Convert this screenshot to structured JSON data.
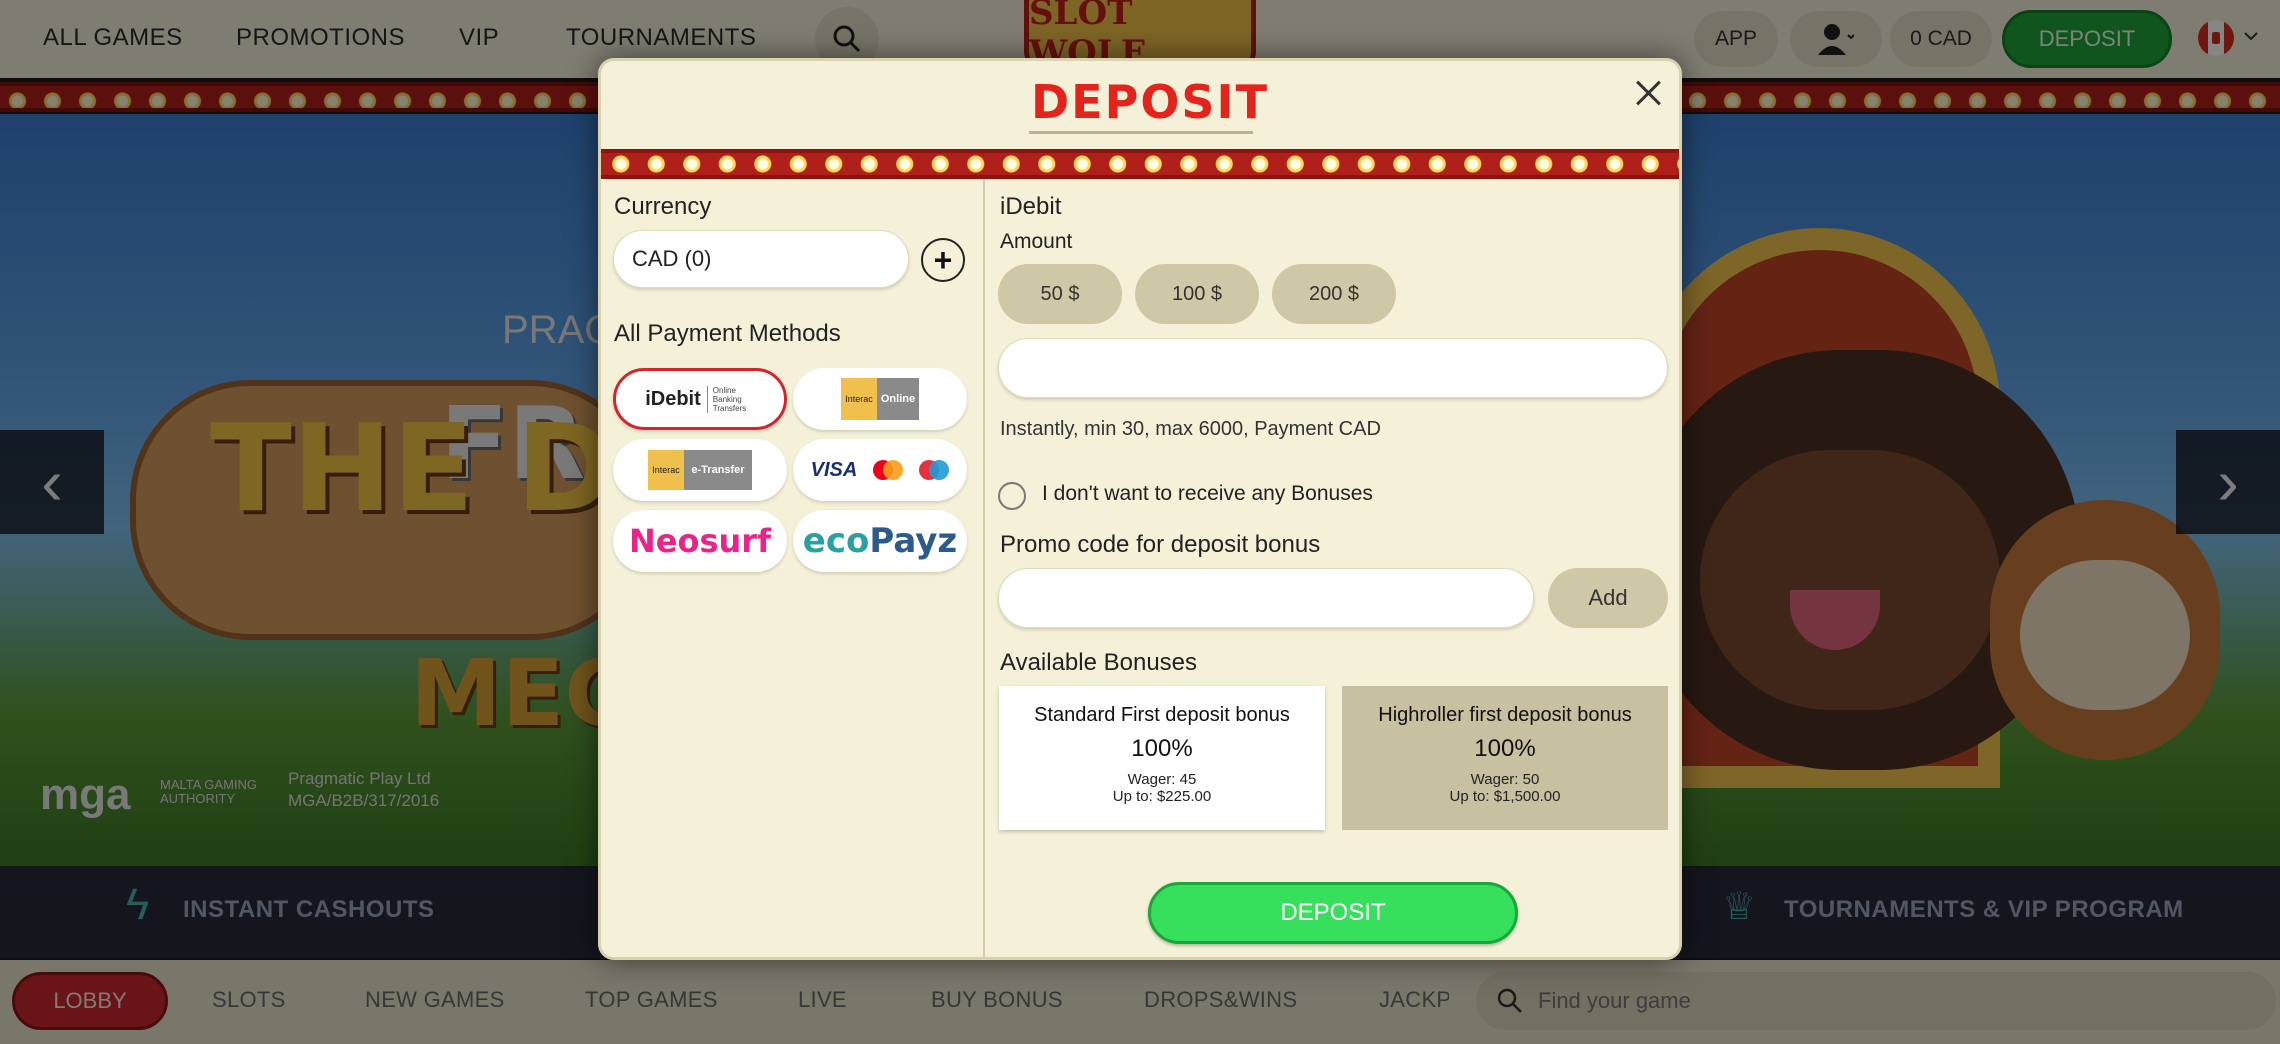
{
  "topnav": {
    "items": [
      "ALL GAMES",
      "PROMOTIONS",
      "VIP",
      "TOURNAMENTS"
    ],
    "logo_text": "SLOT WOLF",
    "app": "APP",
    "balance": "0 CAD",
    "deposit": "DEPOSIT"
  },
  "hero": {
    "provider": "PRAG",
    "line1": "FR",
    "title": "THE DOG",
    "subtitle": "MEG",
    "mga": "mga",
    "mga_text1": "MALTA GAMING",
    "mga_text2": "AUTHORITY",
    "license1": "Pragmatic Play Ltd",
    "license2": "MGA/B2B/317/2016"
  },
  "features": [
    "INSTANT CASHOUTS",
    "TOURNAMENTS & VIP PROGRAM"
  ],
  "bottomnav": {
    "lobby": "LOBBY",
    "items": [
      "SLOTS",
      "NEW GAMES",
      "TOP GAMES",
      "LIVE",
      "BUY BONUS",
      "DROPS&WINS",
      "JACKP"
    ],
    "search_placeholder": "Find your game"
  },
  "modal": {
    "title": "DEPOSIT",
    "currency_label": "Currency",
    "currency_value": "CAD (0)",
    "methods_label": "All Payment Methods",
    "methods": {
      "idebit": "iDebit",
      "idebit_small": "Online Banking Transfers",
      "interac": "Interac",
      "interac_online": "Online",
      "interac_etransfer": "e-Transfer",
      "visa": "VISA",
      "neosurf": "Neosurf",
      "ecopayz_a": "eco",
      "ecopayz_b": "Payz"
    },
    "selected_method": "iDebit",
    "amount_label": "Amount",
    "amounts": [
      "50 $",
      "100 $",
      "200 $"
    ],
    "amount_value": "",
    "info": "Instantly, min 30, max 6000, Payment CAD",
    "no_bonus_label": "I don't want to receive any Bonuses",
    "promo_label": "Promo code for deposit bonus",
    "promo_value": "",
    "add_label": "Add",
    "bonuses_label": "Available Bonuses",
    "bonuses": [
      {
        "name": "Standard First deposit bonus",
        "percent": "100%",
        "wager": "Wager: 45",
        "upto": "Up to: $225.00"
      },
      {
        "name": "Highroller first deposit bonus",
        "percent": "100%",
        "wager": "Wager: 50",
        "upto": "Up to: $1,500.00"
      }
    ],
    "deposit_button": "DEPOSIT"
  },
  "colors": {
    "accent_red": "#e4231c",
    "deposit_green": "#36e05c",
    "modal_bg": "#f5f1d8"
  }
}
